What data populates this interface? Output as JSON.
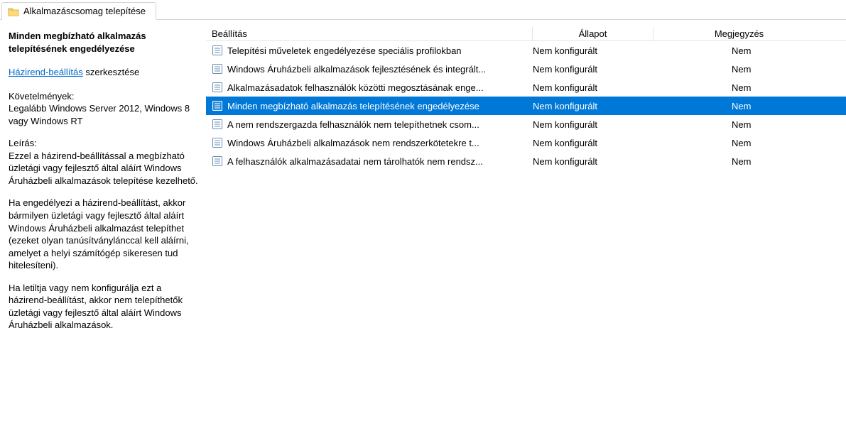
{
  "tab": {
    "title": "Alkalmazáscsomag telepítése"
  },
  "side": {
    "title": "Minden megbízható alkalmazás telepítésének engedélyezése",
    "edit_link": "Házirend-beállítás",
    "edit_suffix": " szerkesztése",
    "req_heading": "Követelmények:",
    "req_body": "Legalább Windows Server 2012, Windows 8 vagy Windows RT",
    "desc_heading": "Leírás:",
    "desc_p1": "Ezzel a házirend-beállítással a megbízható üzletági vagy fejlesztő által aláírt Windows Áruházbeli alkalmazások telepítése kezelhető.",
    "desc_p2": "Ha engedélyezi a házirend-beállítást, akkor bármilyen üzletági vagy fejlesztő által aláírt Windows Áruházbeli alkalmazást telepíthet (ezeket olyan tanúsítványlánccal kell aláírni, amelyet a helyi számítógép sikeresen tud hitelesíteni).",
    "desc_p3": "Ha letiltja vagy nem konfigurálja ezt a házirend-beállítást, akkor nem telepíthetők üzletági vagy fejlesztő által aláírt Windows Áruházbeli alkalmazások."
  },
  "columns": {
    "setting": "Beállítás",
    "state": "Állapot",
    "comment": "Megjegyzés"
  },
  "rows": [
    {
      "setting": "Telepítési műveletek engedélyezése speciális profilokban",
      "state": "Nem konfigurált",
      "comment": "Nem",
      "selected": false
    },
    {
      "setting": "Windows Áruházbeli alkalmazások fejlesztésének és integrált...",
      "state": "Nem konfigurált",
      "comment": "Nem",
      "selected": false
    },
    {
      "setting": "Alkalmazásadatok felhasználók közötti megosztásának enge...",
      "state": "Nem konfigurált",
      "comment": "Nem",
      "selected": false
    },
    {
      "setting": "Minden megbízható alkalmazás telepítésének engedélyezése",
      "state": "Nem konfigurált",
      "comment": "Nem",
      "selected": true
    },
    {
      "setting": "A nem rendszergazda felhasználók nem telepíthetnek csom...",
      "state": "Nem konfigurált",
      "comment": "Nem",
      "selected": false
    },
    {
      "setting": "Windows Áruházbeli alkalmazások nem rendszerkötetekre t...",
      "state": "Nem konfigurált",
      "comment": "Nem",
      "selected": false
    },
    {
      "setting": "A felhasználók alkalmazásadatai nem tárolhatók nem rendsz...",
      "state": "Nem konfigurált",
      "comment": "Nem",
      "selected": false
    }
  ]
}
